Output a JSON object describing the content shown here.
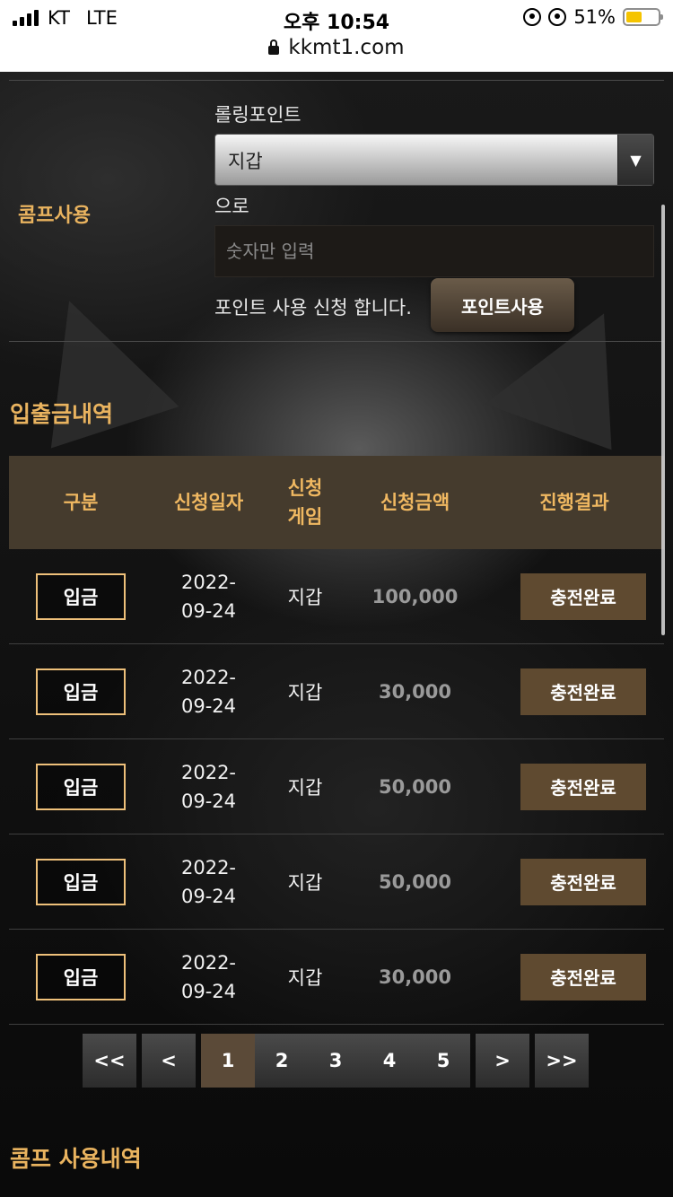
{
  "status_bar": {
    "carrier": "KT",
    "network": "LTE",
    "time": "오후 10:54",
    "battery": "51%",
    "url": "kkmt1.com"
  },
  "comp_form": {
    "section_label": "콤프사용",
    "rolling_label": "롤링포인트",
    "select_value": "지갑",
    "to_label": "으로",
    "input_placeholder": "숫자만 입력",
    "apply_text": "포인트 사용 신청 합니다.",
    "apply_button": "포인트사용"
  },
  "deposit_history": {
    "title": "입출금내역",
    "columns": [
      "구분",
      "신청일자",
      "신청\n게임",
      "신청금액",
      "진행결과"
    ],
    "rows": [
      {
        "type": "입금",
        "date": "2022-\n09-24",
        "game": "지갑",
        "amount": "100,000",
        "status": "충전완료"
      },
      {
        "type": "입금",
        "date": "2022-\n09-24",
        "game": "지갑",
        "amount": "30,000",
        "status": "충전완료"
      },
      {
        "type": "입금",
        "date": "2022-\n09-24",
        "game": "지갑",
        "amount": "50,000",
        "status": "충전완료"
      },
      {
        "type": "입금",
        "date": "2022-\n09-24",
        "game": "지갑",
        "amount": "50,000",
        "status": "충전완료"
      },
      {
        "type": "입금",
        "date": "2022-\n09-24",
        "game": "지갑",
        "amount": "30,000",
        "status": "충전완료"
      }
    ]
  },
  "pagination": {
    "first": "<<",
    "prev": "<",
    "pages": [
      "1",
      "2",
      "3",
      "4",
      "5"
    ],
    "current": "1",
    "next": ">",
    "last": ">>"
  },
  "comp_history": {
    "title": "콤프 사용내역"
  },
  "colors": {
    "accent_gold": "#e9b35f",
    "header_brown": "#453b2d",
    "status_brown": "#5f4a30"
  }
}
